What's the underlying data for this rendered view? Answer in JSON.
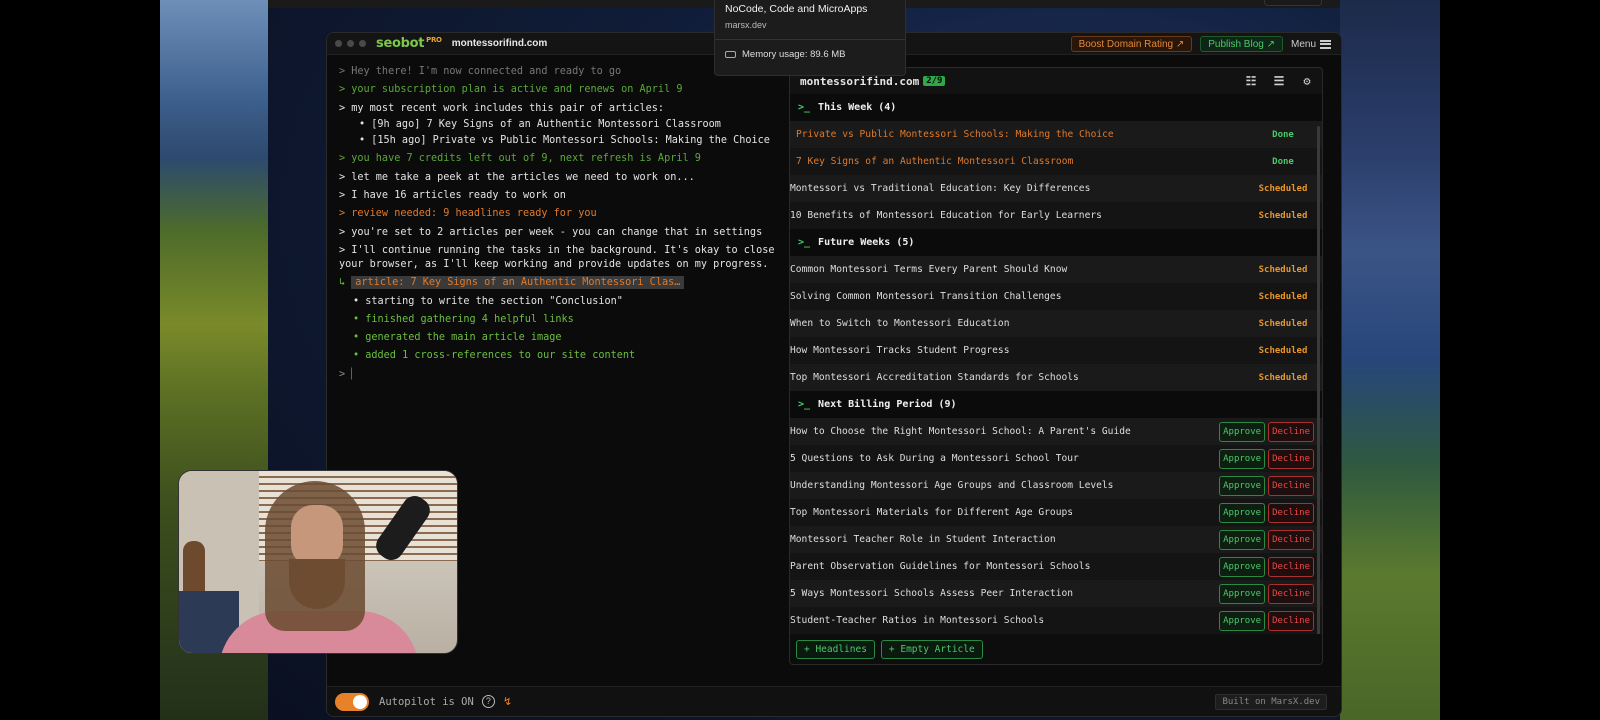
{
  "app": {
    "logo": "seobot",
    "logo_badge": "PRO",
    "domain": "montessorifind.com",
    "boost_label": "Boost Domain Rating ↗",
    "publish_label": "Publish Blog ↗",
    "menu_label": "Menu"
  },
  "popover": {
    "title": "NoCode, Code and MicroApps",
    "subtitle": "marsx.dev",
    "memory": "Memory usage: 89.6 MB"
  },
  "log": {
    "l1": "> Hey there! I'm now connected and ready to go",
    "l2": "> your subscription plan is active and renews on April 9",
    "l3": "> my most recent work includes this pair of articles:",
    "b1": "• [9h ago] 7 Key Signs of an Authentic Montessori Classroom",
    "b2": "• [15h ago] Private vs Public Montessori Schools: Making the Choice",
    "l4": "> you have 7 credits left out of 9, next refresh is April 9",
    "l5": "> let me take a peek at the articles we need to work on...",
    "l6": "> I have 16 articles ready to work on",
    "l7": "> review needed: 9 headlines ready for you",
    "l8": "> you're set to 2 articles per week - you can change that in settings",
    "l9": "> I'll continue running the tasks in the background. It's okay to close your browser, as I'll keep working and provide updates on my progress.",
    "article_prefix": "↳",
    "article_label": "article: 7 Key Signs of an Authentic Montessori Clas…",
    "a1": "• starting to write the section \"Conclusion\"",
    "a2": "• finished gathering 4 helpful links",
    "a3": "• generated the main article image",
    "a4": "• added 1 cross-references to our site content",
    "prompt": ">",
    "cursor": "▏"
  },
  "panel": {
    "domain": "montessorifind.com",
    "count": "2/9",
    "sections": {
      "this_week": "This Week (4)",
      "future_weeks": "Future Weeks (5)",
      "next_billing": "Next Billing Period (9)"
    },
    "prompt_symbol": ">_",
    "this_week": [
      {
        "title": "Private vs Public Montessori Schools: Making the Choice",
        "status": "Done"
      },
      {
        "title": "7 Key Signs of an Authentic Montessori Classroom",
        "status": "Done"
      },
      {
        "title": "Montessori vs Traditional Education: Key Differences",
        "status": "Scheduled"
      },
      {
        "title": "10 Benefits of Montessori Education for Early Learners",
        "status": "Scheduled"
      }
    ],
    "future_weeks": [
      {
        "title": "Common Montessori Terms Every Parent Should Know",
        "status": "Scheduled"
      },
      {
        "title": "Solving Common Montessori Transition Challenges",
        "status": "Scheduled"
      },
      {
        "title": "When to Switch to Montessori Education",
        "status": "Scheduled"
      },
      {
        "title": "How Montessori Tracks Student Progress",
        "status": "Scheduled"
      },
      {
        "title": "Top Montessori Accreditation Standards for Schools",
        "status": "Scheduled"
      }
    ],
    "next_billing": [
      "How to Choose the Right Montessori School: A Parent's Guide",
      "5 Questions to Ask During a Montessori School Tour",
      "Understanding Montessori Age Groups and Classroom Levels",
      "Top Montessori Materials for Different Age Groups",
      "Montessori Teacher Role in Student Interaction",
      "Parent Observation Guidelines for Montessori Schools",
      "5 Ways Montessori Schools Assess Peer Interaction",
      "Student-Teacher Ratios in Montessori Schools"
    ],
    "approve_label": "Approve",
    "decline_label": "Decline",
    "footer": {
      "headlines": "+ Headlines",
      "empty_article": "+ Empty Article"
    }
  },
  "bottom": {
    "autopilot": "Autopilot is ON",
    "built": "Built on MarsX.dev"
  },
  "colors": {
    "accent_green": "#4ac86a",
    "accent_orange": "#e8822a",
    "decline_red": "#e84a4a"
  }
}
